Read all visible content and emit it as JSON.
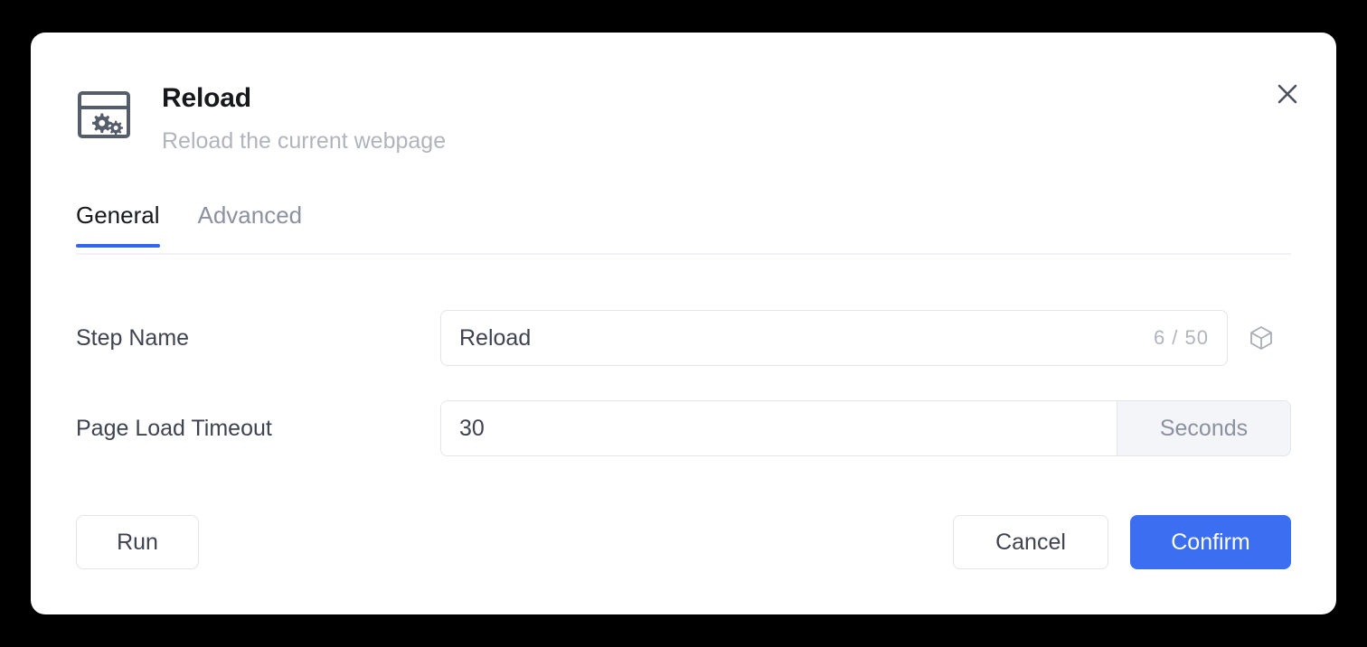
{
  "dialog": {
    "icon": "browser-settings-icon",
    "title": "Reload",
    "subtitle": "Reload the current webpage",
    "close_icon": "close-icon"
  },
  "tabs": [
    {
      "label": "General",
      "active": true
    },
    {
      "label": "Advanced",
      "active": false
    }
  ],
  "form": {
    "step_name": {
      "label": "Step Name",
      "value": "Reload",
      "placeholder": "Step Name",
      "counter": "6 / 50",
      "side_icon": "cube-icon"
    },
    "page_load_timeout": {
      "label": "Page Load Timeout",
      "value": "30",
      "placeholder": "30",
      "unit": "Seconds"
    }
  },
  "footer": {
    "run_label": "Run",
    "cancel_label": "Cancel",
    "confirm_label": "Confirm"
  },
  "colors": {
    "accent": "#3b6ef0",
    "tab_underline": "#3366ee",
    "title": "#17181c",
    "subtitle": "#b1b4bd",
    "label": "#3e434f",
    "border": "#e3e5ea",
    "addon_bg": "#f4f5f8",
    "backdrop": "#000000",
    "surface": "#ffffff"
  }
}
